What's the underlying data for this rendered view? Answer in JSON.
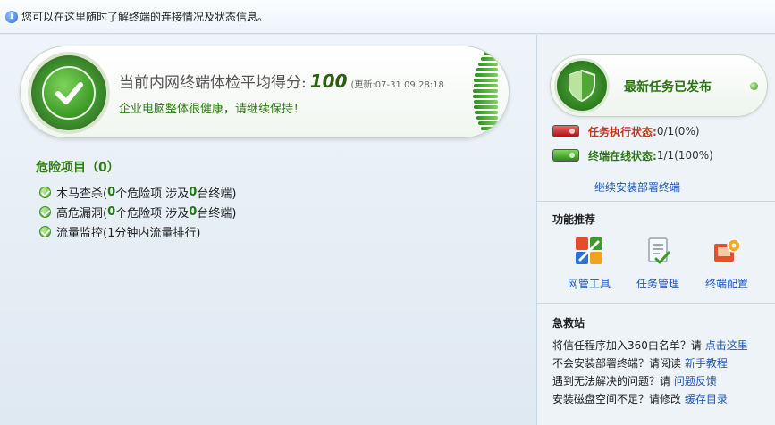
{
  "topbar": {
    "info_text": "您可以在这里随时了解终端的连接情况及状态信息。"
  },
  "score": {
    "label": "当前内网终端体检平均得分:",
    "value": "100",
    "update_text": "(更新:07-31 09:28:18",
    "status": "企业电脑整体很健康，请继续保持！"
  },
  "danger": {
    "title": "危险项目（0）",
    "items": [
      {
        "pre": "木马查杀(",
        "n1": "0",
        "mid": " 个危险项 涉及 ",
        "n2": "0",
        "post": " 台终端)"
      },
      {
        "pre": "高危漏洞(",
        "n1": "0",
        "mid": " 个危险项 涉及 ",
        "n2": "0",
        "post": " 台终端)"
      },
      {
        "text": "流量监控(1分钟内流量排行)"
      }
    ]
  },
  "tasks": {
    "title": "最新任务已发布",
    "exec_label": "任务执行状态:",
    "exec_value": "0/1(0%)",
    "online_label": "终端在线状态:",
    "online_value": "1/1(100%)",
    "deploy_link": "继续安装部署终端"
  },
  "features": {
    "title": "功能推荐",
    "items": [
      "网管工具",
      "任务管理",
      "终端配置"
    ]
  },
  "rescue": {
    "title": "急救站",
    "lines": [
      {
        "text": "将信任程序加入360白名单？请 ",
        "link": "点击这里"
      },
      {
        "text": "不会安装部署终端？请阅读 ",
        "link": "新手教程"
      },
      {
        "text": "遇到无法解决的问题？请 ",
        "link": "问题反馈"
      },
      {
        "text": "安装磁盘空间不足？请修改 ",
        "link": "缓存目录"
      }
    ]
  },
  "colors": {
    "accent_green": "#2c7c10",
    "link_blue": "#1f57b8",
    "alert_red": "#c2371f"
  }
}
